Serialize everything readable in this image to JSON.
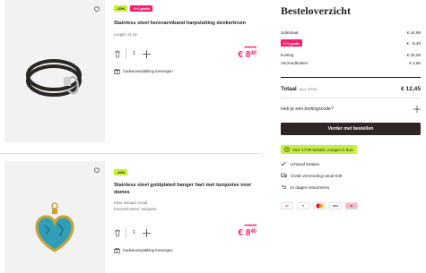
{
  "cart": {
    "items": [
      {
        "labels": [
          "-10%",
          "1+1 gratis"
        ],
        "name": "Stainless steel herenarmband harpsluiting donkerbruin",
        "meta": [
          "Lengte: 21 cm"
        ],
        "quantity": "1",
        "old_price": "€ 29,90",
        "new_price_main": "€ 8",
        "new_price_cents": "40",
        "gift_label": "Cadeauverpakking toevoegen"
      },
      {
        "labels": [
          "-10%"
        ],
        "name": "Stainless steel goldplated hanger hart met turquoise voor dames",
        "meta": [
          "Kleur sieraad: Goud",
          "Kenmerk steen: turquoise"
        ],
        "quantity": "1",
        "old_price": "€ 15,90",
        "new_price_main": "€ 8",
        "new_price_cents": "40",
        "gift_label": "Cadeauverpakking toevoegen"
      }
    ]
  },
  "summary": {
    "title": "Besteloverzicht",
    "subtotal_label": "Subtotaal",
    "subtotal_value": "€ 44,96",
    "promo_tag": "1+1 gratis",
    "promo_value": "€ - 8,40",
    "discount_label": "Korting",
    "discount_value": "- € 26,08",
    "shipping_label": "Verzendkosten",
    "shipping_value": "€ 3,95",
    "total_label": "Totaal",
    "total_sub": "(incl. BTW)",
    "total_value": "€ 12,45",
    "coupon_label": "Heb je een kortingscode?",
    "cta_label": "Verder met bestellen",
    "promo_banner": "Voor 17:00 besteld, morgen in huis",
    "usps": [
      "Achteraf betalen",
      "Gratis verzending vanaf €49",
      "14 dagen retourneren"
    ],
    "payment_methods": [
      "iDEAL",
      "PayPal",
      "Mastercard",
      "VISA",
      "Klarna"
    ]
  },
  "colors": {
    "accent_pink": "#ff1e6d",
    "accent_lime": "#c7ef3d",
    "cta_dark": "#302424"
  }
}
